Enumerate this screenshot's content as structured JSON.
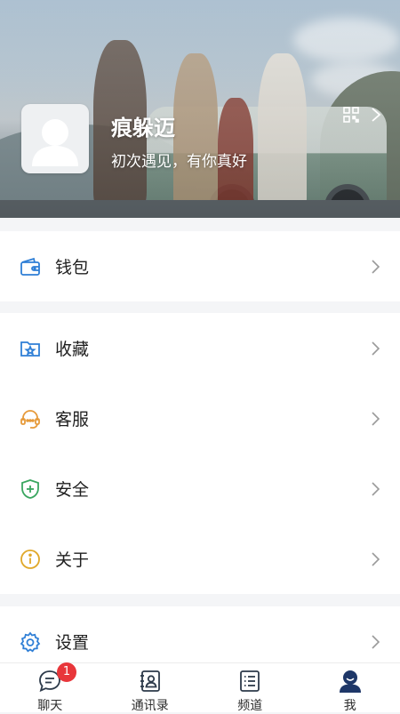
{
  "profile": {
    "name": "痕躲迈",
    "bio": "初次遇见，有你真好"
  },
  "menu": {
    "wallet": "钱包",
    "favorites": "收藏",
    "support": "客服",
    "security": "安全",
    "about": "关于",
    "settings": "设置"
  },
  "tabs": {
    "chat": "聊天",
    "contacts": "通讯录",
    "channels": "频道",
    "me": "我",
    "chat_badge": "1"
  },
  "colors": {
    "accent": "#2f7fd6",
    "support_icon": "#e69a3a",
    "security_icon": "#3aa660",
    "about_icon": "#e0a82a",
    "badge": "#e8363a",
    "active_tab": "#1e3768"
  }
}
